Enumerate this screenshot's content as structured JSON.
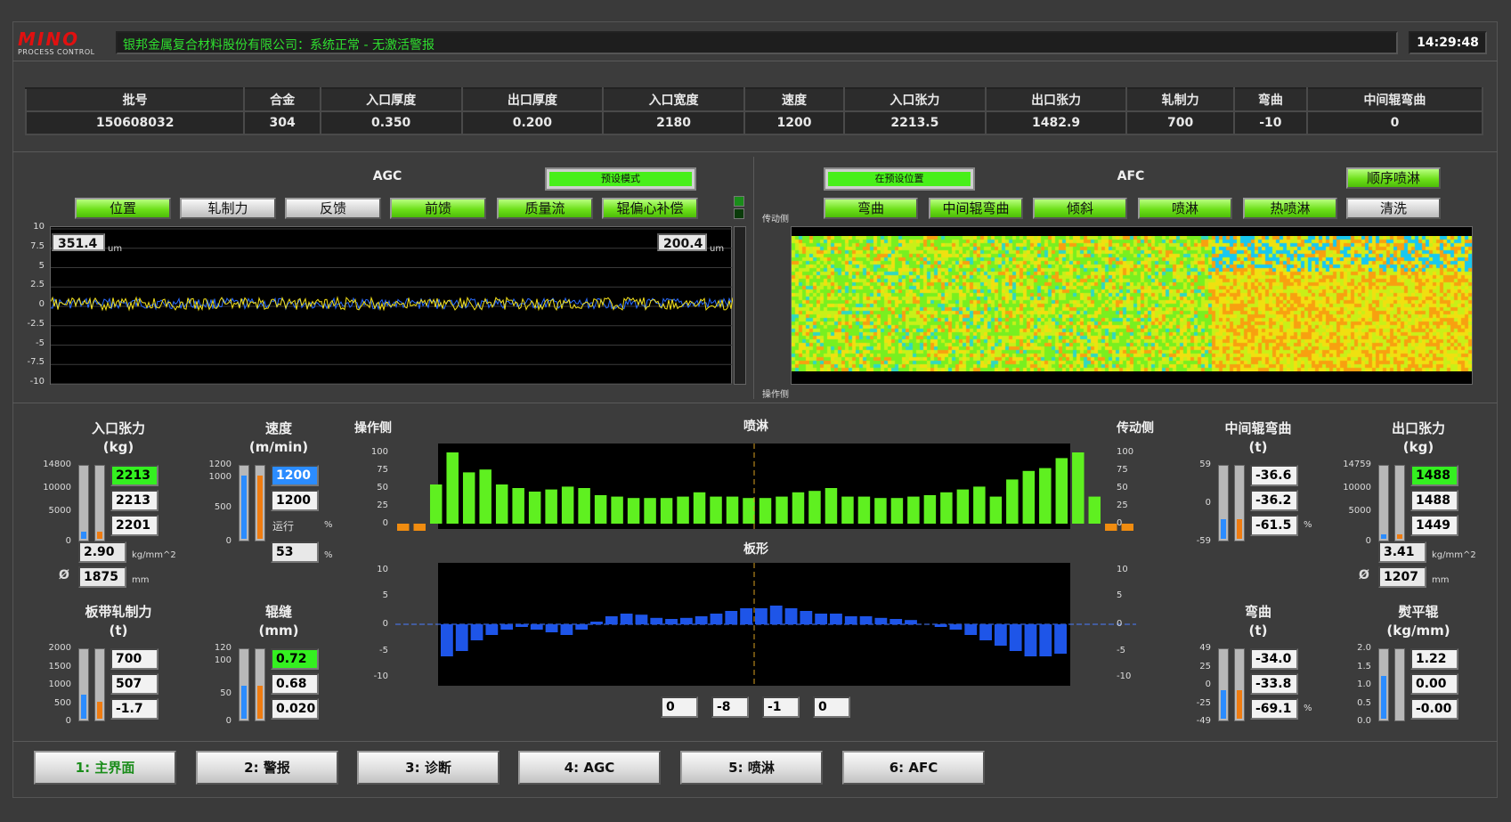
{
  "header": {
    "logo_main": "MINO",
    "logo_sub": "PROCESS CONTROL",
    "status": "银邦金属复合材料股份有限公司：系统正常 - 无激活警报",
    "time": "14:29:48"
  },
  "params": {
    "headers": [
      "批号",
      "合金",
      "入口厚度",
      "出口厚度",
      "入口宽度",
      "速度",
      "入口张力",
      "出口张力",
      "轧制力",
      "弯曲",
      "中间辊弯曲"
    ],
    "values": [
      "150608032",
      "304",
      "0.350",
      "0.200",
      "2180",
      "1200",
      "2213.5",
      "1482.9",
      "700",
      "-10",
      "0"
    ]
  },
  "agc": {
    "title": "AGC",
    "mode_button": "预设模式",
    "buttons": [
      "位置",
      "轧制力",
      "反馈",
      "前馈",
      "质量流",
      "辊偏心补偿"
    ],
    "left_value": "351.4",
    "right_value": "200.4",
    "unit": "um",
    "y_ticks": [
      "10",
      "7.5",
      "5",
      "2.5",
      "0",
      "-2.5",
      "-5",
      "-7.5",
      "-10"
    ]
  },
  "afc": {
    "title": "AFC",
    "mode_button": "在预设位置",
    "spray_button": "顺序喷淋",
    "buttons": [
      "弯曲",
      "中间辊弯曲",
      "倾斜",
      "喷淋",
      "热喷淋",
      "清洗"
    ],
    "drive_side": "传动侧",
    "operator_side": "操作侧"
  },
  "gauges_left": {
    "entry_tension": {
      "title": "入口张力",
      "unit": "(kg)",
      "ticks": [
        "14800",
        "10000",
        "5000",
        "0"
      ],
      "v1": "2213",
      "v2": "2213",
      "v3": "2201",
      "stress": "2.90",
      "stress_unit": "kg/mm^2",
      "diam_symbol": "Ø",
      "diam": "1875",
      "diam_unit": "mm"
    },
    "speed": {
      "title": "速度",
      "unit": "(m/min)",
      "ticks": [
        "1200",
        "1000",
        "500",
        "0"
      ],
      "v1": "1200",
      "v2": "1200",
      "run_label": "运行",
      "pct": "53",
      "pct_unit": "%"
    },
    "strip_force": {
      "title": "板带轧制力",
      "unit": "(t)",
      "ticks": [
        "2000",
        "1500",
        "1000",
        "500",
        "0"
      ],
      "v1": "700",
      "v2": "507",
      "v3": "-1.7"
    },
    "gap": {
      "title": "辊缝",
      "unit": "(mm)",
      "ticks": [
        "120",
        "100",
        "50",
        "0"
      ],
      "v1": "0.72",
      "v2": "0.68",
      "v3": "0.020"
    }
  },
  "spray": {
    "title": "喷淋",
    "op_side": "操作侧",
    "drive_side": "传动侧",
    "y_ticks": [
      "100",
      "75",
      "50",
      "25",
      "0"
    ],
    "values": [
      -10,
      -10,
      55,
      100,
      72,
      76,
      55,
      50,
      45,
      48,
      52,
      50,
      40,
      38,
      36,
      36,
      36,
      38,
      44,
      38,
      38,
      36,
      36,
      38,
      44,
      46,
      50,
      38,
      38,
      36,
      36,
      38,
      40,
      44,
      48,
      52,
      38,
      62,
      74,
      78,
      92,
      100,
      38,
      -10,
      -10
    ]
  },
  "shape": {
    "title": "板形",
    "y_ticks": [
      "10",
      "5",
      "0",
      "-5",
      "-10"
    ],
    "values": [
      -6,
      -5,
      -3,
      -2,
      -1,
      -0.5,
      -1,
      -1.5,
      -2,
      -1,
      0.5,
      1.5,
      2,
      1.8,
      1.2,
      1,
      1.2,
      1.5,
      2,
      2.5,
      3,
      3,
      3.5,
      3,
      2.5,
      2,
      2,
      1.5,
      1.5,
      1.2,
      1,
      0.8,
      0,
      -0.5,
      -1,
      -2,
      -3,
      -4,
      -5,
      -6,
      -6,
      -5.5
    ],
    "settings": [
      "0",
      "-8",
      "-1",
      "0"
    ]
  },
  "gauges_right": {
    "ir_bend": {
      "title": "中间辊弯曲",
      "unit": "(t)",
      "ticks": [
        "59",
        "0",
        "-59"
      ],
      "v1": "-36.6",
      "v2": "-36.2",
      "v3": "-61.5",
      "pct_unit": "%"
    },
    "exit_tension": {
      "title": "出口张力",
      "unit": "(kg)",
      "ticks": [
        "14759",
        "10000",
        "5000",
        "0"
      ],
      "v1": "1488",
      "v2": "1488",
      "v3": "1449",
      "stress": "3.41",
      "stress_unit": "kg/mm^2",
      "diam_symbol": "Ø",
      "diam": "1207",
      "diam_unit": "mm"
    },
    "bend": {
      "title": "弯曲",
      "unit": "(t)",
      "ticks": [
        "49",
        "25",
        "0",
        "-25",
        "-49"
      ],
      "v1": "-34.0",
      "v2": "-33.8",
      "v3": "-69.1",
      "pct_unit": "%"
    },
    "flatten": {
      "title": "熨平辊",
      "unit": "(kg/mm)",
      "ticks": [
        "2.0",
        "1.5",
        "1.0",
        "0.5",
        "0.0"
      ],
      "v1": "1.22",
      "v2": "0.00",
      "v3": "-0.00"
    }
  },
  "tabs": [
    "1: 主界面",
    "2: 警报",
    "3: 诊断",
    "4: AGC",
    "5: 喷淋",
    "6: AFC"
  ]
}
